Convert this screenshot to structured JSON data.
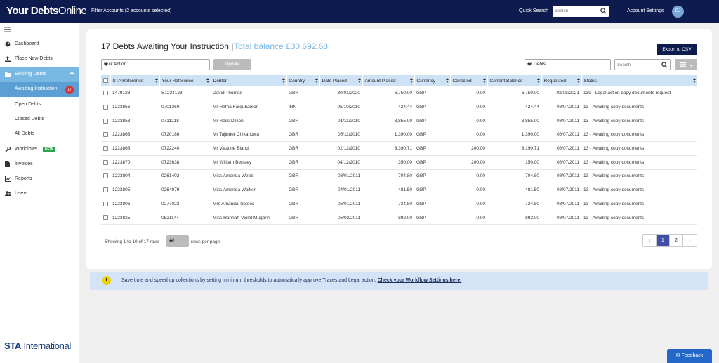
{
  "header": {
    "brand_bold": "Your Debts",
    "brand_thin": "Online",
    "filter_text": "Filter Accounts (2 accounts selected)",
    "quick_search_label": "Quick Search",
    "quick_search_placeholder": "Search",
    "account_settings": "Account Settings",
    "avatar_initials": "DJ"
  },
  "sidebar": {
    "items": [
      {
        "label": "Dashboard",
        "icon": "dashboard-icon"
      },
      {
        "label": "Place New Debts",
        "icon": "upload-icon"
      },
      {
        "label": "Existing Debts",
        "icon": "folder-icon"
      },
      {
        "label": "Awaiting Instruction",
        "badge": "17"
      },
      {
        "label": "Open Debts"
      },
      {
        "label": "Closed Debts"
      },
      {
        "label": "All Debts"
      },
      {
        "label": "Workflows",
        "icon": "wrench-icon",
        "badge": "NEW"
      },
      {
        "label": "Invoices",
        "icon": "document-icon"
      },
      {
        "label": "Reports",
        "icon": "chart-icon"
      },
      {
        "label": "Users",
        "icon": "users-icon"
      }
    ],
    "logo_text": "STA",
    "logo_sub": "International"
  },
  "main": {
    "title": "17 Debts Awaiting Your Instruction |",
    "balance": "Total balance £30,692.68",
    "export_label": "Export to CSV",
    "bulk_action": "Bulk Action",
    "update_label": "Update",
    "filter_select": "All Debts",
    "search_placeholder": "Search",
    "columns": [
      "STA Reference",
      "Your Reference",
      "Debtor",
      "Country",
      "Date Placed",
      "Amount Placed",
      "Currency",
      "Collected",
      "Current Balance",
      "Requested",
      "Status"
    ],
    "rows": [
      [
        "1479128",
        "S1234123",
        "David Thomas",
        "GBR",
        "30/01/2020",
        "6,750.00",
        "GBP",
        "0.00",
        "6,750.00",
        "02/08/2021",
        "139 - Legal action copy documents request"
      ],
      [
        "1223856",
        "0701260",
        "Mr Rafha Farquharson",
        "IRN",
        "05/10/2010",
        "424.44",
        "GBP",
        "0.00",
        "424.44",
        "08/07/2011",
        "13 - Awaiting copy documents"
      ],
      [
        "1223858",
        "0711218",
        "Mr Ross Dillion",
        "GBR",
        "01/11/2010",
        "3,855.00",
        "GBP",
        "0.00",
        "3,855.00",
        "08/07/2011",
        "13 - Awaiting copy documents"
      ],
      [
        "1223863",
        "0720186",
        "Mr Tajinder Chikandwa",
        "GBR",
        "05/11/2010",
        "1,390.00",
        "GBP",
        "0.00",
        "1,390.00",
        "08/07/2011",
        "13 - Awaiting copy documents"
      ],
      [
        "1223868",
        "0722240",
        "Mr Valatine Bland",
        "GBR",
        "02/12/2010",
        "3,390.71",
        "GBP",
        "200.00",
        "3,190.71",
        "08/07/2011",
        "13 - Awaiting copy documents"
      ],
      [
        "1223870",
        "0723638",
        "Mr William Bensley",
        "GBR",
        "04/12/2010",
        "350.00",
        "GBP",
        "200.00",
        "150.00",
        "08/07/2011",
        "13 - Awaiting copy documents"
      ],
      [
        "1223804",
        "0261402",
        "Miss Amanda Webb",
        "GBR",
        "03/01/2011",
        "704.80",
        "GBP",
        "0.00",
        "704.80",
        "08/07/2011",
        "13 - Awaiting copy documents"
      ],
      [
        "1223805",
        "0264979",
        "Miss Amanda Walker",
        "GBR",
        "04/01/2011",
        "481.50",
        "GBP",
        "0.00",
        "481.50",
        "08/07/2011",
        "13 - Awaiting copy documents"
      ],
      [
        "1223806",
        "0277022",
        "Mrs Amanda Tiptoes",
        "GBR",
        "05/01/2011",
        "724.80",
        "GBP",
        "0.00",
        "724.80",
        "08/07/2011",
        "13 - Awaiting copy documents"
      ],
      [
        "1223825",
        "0521144",
        "Miss Hannah-Violet Mugariri",
        "GBR",
        "05/02/2011",
        "892.00",
        "GBP",
        "0.00",
        "892.00",
        "08/07/2011",
        "13 - Awaiting copy documents"
      ]
    ],
    "showing_text": "Showing 1 to 10 of 17 rows",
    "rows_per_page_value": "10",
    "rows_per_page_label": "rows per page",
    "pager": {
      "prev": "‹",
      "pages": [
        "1",
        "2"
      ],
      "next": "›",
      "current": "1"
    }
  },
  "banner": {
    "message": "Save time and speed up collections by setting minimum thresholds to automatically approve Traces and Legal action.",
    "link": "Check your Workflow Settings here."
  },
  "feedback_label": "Feedback",
  "colors": {
    "navy": "#0d1b4f",
    "accent": "#7ab8e4",
    "header_row": "#cde2f5",
    "badge_red": "#d9323c",
    "new_green": "#2aa44a"
  }
}
